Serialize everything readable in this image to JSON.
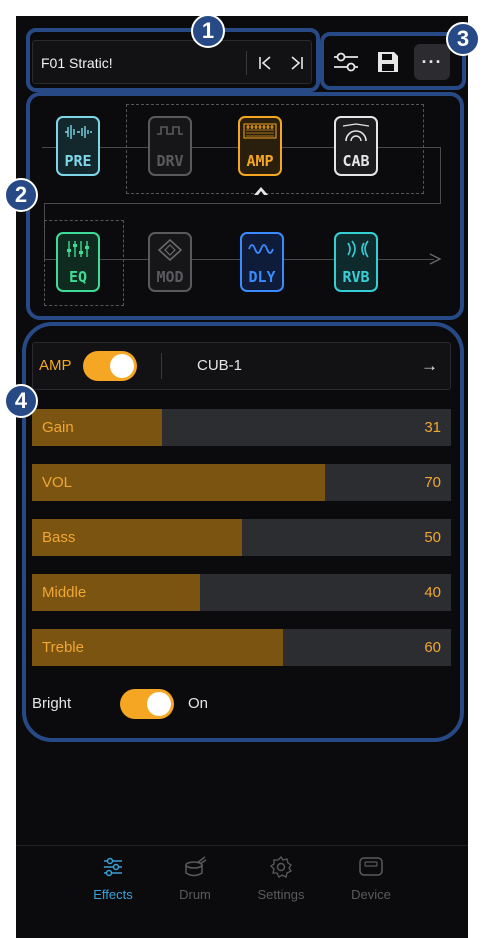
{
  "preset": {
    "name": "F01  Stratic!",
    "prev_glyph": "|<",
    "next_glyph": ">|"
  },
  "toolbar": {
    "icons": [
      "sliders-icon",
      "save-icon",
      "more-icon"
    ],
    "more_glyph": "···"
  },
  "callouts": [
    "1",
    "2",
    "3",
    "4"
  ],
  "chain": {
    "row1": [
      {
        "label": "PRE",
        "color": "#7fd6e8",
        "active": true
      },
      {
        "label": "DRV",
        "color": "#5a5a5e",
        "active": false
      },
      {
        "label": "AMP",
        "color": "#f5a623",
        "active": true,
        "selected": true
      },
      {
        "label": "CAB",
        "color": "#e6e6e6",
        "active": true
      }
    ],
    "row2": [
      {
        "label": "EQ",
        "color": "#3ddc97",
        "active": true
      },
      {
        "label": "MOD",
        "color": "#5a5a5e",
        "active": false
      },
      {
        "label": "DLY",
        "color": "#3a8bff",
        "active": true
      },
      {
        "label": "RVB",
        "color": "#35d0d6",
        "active": true
      }
    ]
  },
  "amp": {
    "label": "AMP",
    "enabled": true,
    "model": "CUB-1",
    "arrow_glyph": "→"
  },
  "params": [
    {
      "name": "Gain",
      "value": "31",
      "fraction": 0.31
    },
    {
      "name": "VOL",
      "value": "70",
      "fraction": 0.7
    },
    {
      "name": "Bass",
      "value": "50",
      "fraction": 0.5
    },
    {
      "name": "Middle",
      "value": "40",
      "fraction": 0.4
    },
    {
      "name": "Treble",
      "value": "60",
      "fraction": 0.6
    }
  ],
  "bright": {
    "label": "Bright",
    "state": "On",
    "enabled": true
  },
  "tabs": [
    {
      "label": "Effects",
      "icon": "sliders-icon",
      "active": true
    },
    {
      "label": "Drum",
      "icon": "drum-icon",
      "active": false
    },
    {
      "label": "Settings",
      "icon": "gear-icon",
      "active": false
    },
    {
      "label": "Device",
      "icon": "device-icon",
      "active": false
    }
  ],
  "colors": {
    "accent": "#f5a623",
    "callout": "#274a87",
    "active_tab": "#3aa0d8"
  }
}
